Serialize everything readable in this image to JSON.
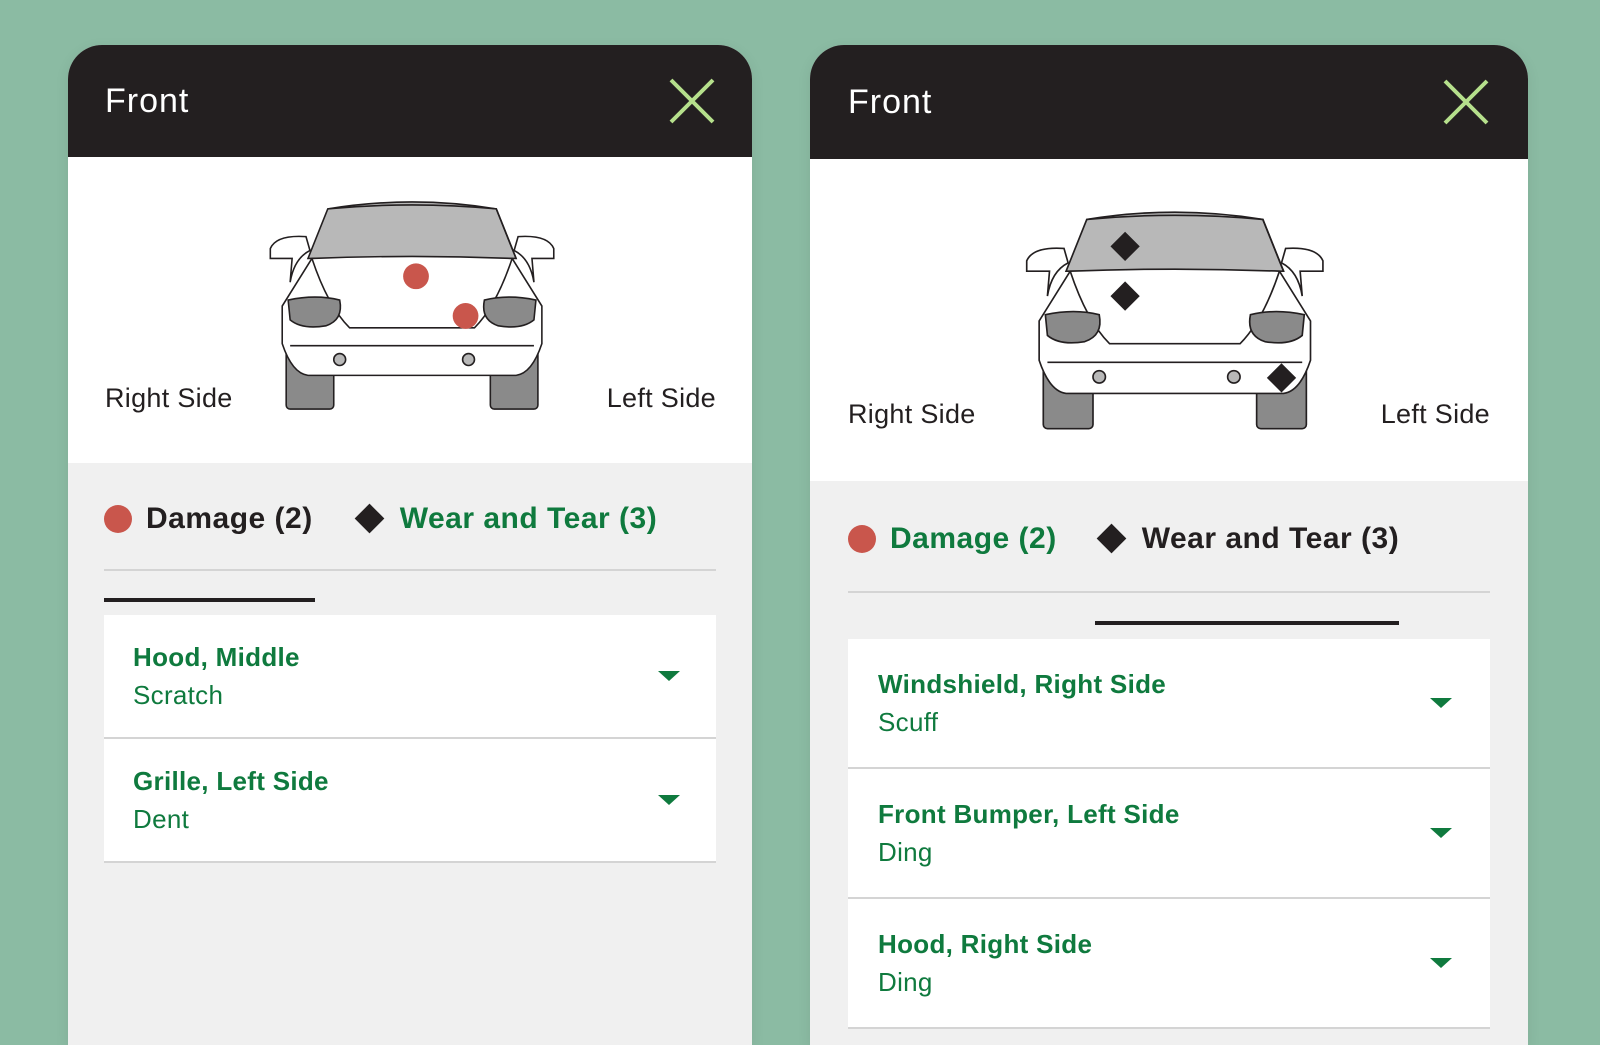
{
  "panels": [
    {
      "title": "Front",
      "side_labels": {
        "right": "Right Side",
        "left": "Left Side"
      },
      "tabs": [
        {
          "label": "Damage (2)",
          "icon": "red-dot-icon",
          "active": true
        },
        {
          "label": "Wear and Tear (3)",
          "icon": "black-diamond-icon",
          "active": false
        }
      ],
      "items": [
        {
          "title": "Hood, Middle",
          "subtitle": "Scratch"
        },
        {
          "title": "Grille, Left Side",
          "subtitle": "Dent"
        }
      ]
    },
    {
      "title": "Front",
      "side_labels": {
        "right": "Right Side",
        "left": "Left Side"
      },
      "tabs": [
        {
          "label": "Damage (2)",
          "icon": "red-dot-icon",
          "active": false
        },
        {
          "label": "Wear and Tear (3)",
          "icon": "black-diamond-icon",
          "active": true
        }
      ],
      "items": [
        {
          "title": "Windshield, Right Side",
          "subtitle": "Scuff"
        },
        {
          "title": "Front Bumper, Left Side",
          "subtitle": "Ding"
        },
        {
          "title": "Hood, Right Side",
          "subtitle": "Ding"
        }
      ]
    }
  ],
  "colors": {
    "background": "#8bbba3",
    "header": "#231f20",
    "accent_green": "#0f7a3e",
    "close_icon": "#b6e08c",
    "damage_marker": "#c9564c",
    "wear_marker": "#231f20"
  }
}
